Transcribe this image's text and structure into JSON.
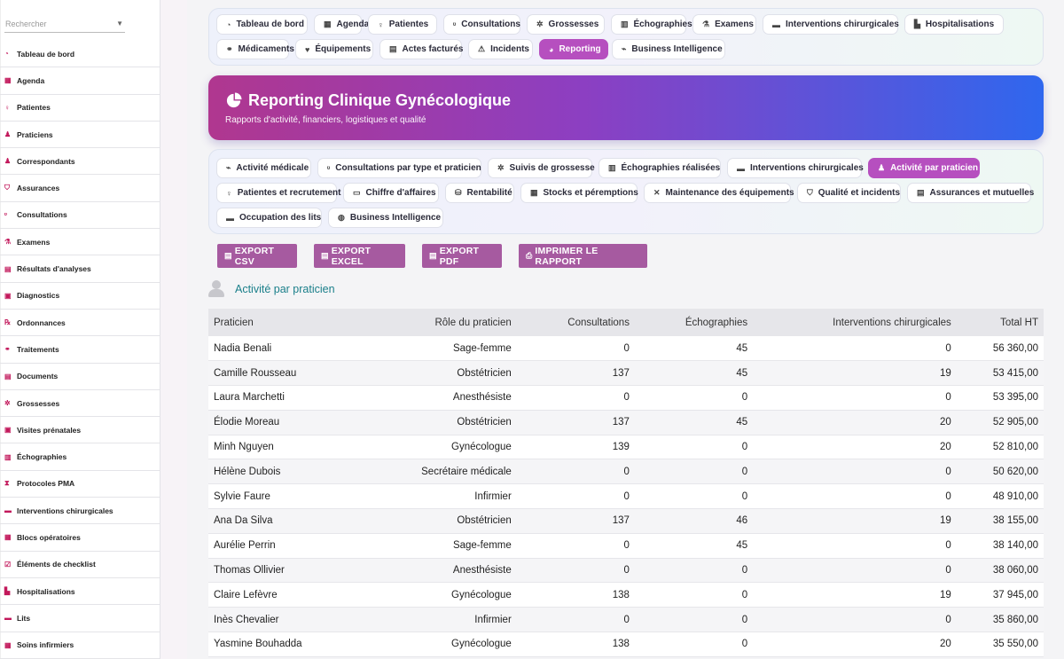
{
  "sidebar": {
    "search_placeholder": "Rechercher",
    "items": [
      {
        "label": "Tableau de bord",
        "icon": "dashboard-icon",
        "glyph": "◔"
      },
      {
        "label": "Agenda",
        "icon": "calendar-icon",
        "glyph": "▦"
      },
      {
        "label": "Patientes",
        "icon": "female-icon",
        "glyph": "♀"
      },
      {
        "label": "Praticiens",
        "icon": "user-doctor-icon",
        "glyph": "♟"
      },
      {
        "label": "Correspondants",
        "icon": "user-icon",
        "glyph": "♟"
      },
      {
        "label": "Assurances",
        "icon": "shield-icon",
        "glyph": "⛉"
      },
      {
        "label": "Consultations",
        "icon": "stethoscope-icon",
        "glyph": "ᶹ"
      },
      {
        "label": "Examens",
        "icon": "microscope-icon",
        "glyph": "⚗"
      },
      {
        "label": "Résultats d'analyses",
        "icon": "results-icon",
        "glyph": "▤"
      },
      {
        "label": "Diagnostics",
        "icon": "clipboard-icon",
        "glyph": "▣"
      },
      {
        "label": "Ordonnances",
        "icon": "prescription-icon",
        "glyph": "℞"
      },
      {
        "label": "Traitements",
        "icon": "pills-icon",
        "glyph": "⚭"
      },
      {
        "label": "Documents",
        "icon": "document-icon",
        "glyph": "▤"
      },
      {
        "label": "Grossesses",
        "icon": "baby-icon",
        "glyph": "✲"
      },
      {
        "label": "Visites prénatales",
        "icon": "visit-icon",
        "glyph": "▣"
      },
      {
        "label": "Échographies",
        "icon": "ultrasound-icon",
        "glyph": "▥"
      },
      {
        "label": "Protocoles PMA",
        "icon": "hourglass-icon",
        "glyph": "⧗"
      },
      {
        "label": "Interventions chirurgicales",
        "icon": "bed-icon",
        "glyph": "▬"
      },
      {
        "label": "Blocs opératoires",
        "icon": "operating-room-icon",
        "glyph": "▦"
      },
      {
        "label": "Éléments de checklist",
        "icon": "checklist-icon",
        "glyph": "☑"
      },
      {
        "label": "Hospitalisations",
        "icon": "hospital-icon",
        "glyph": "▙"
      },
      {
        "label": "Lits",
        "icon": "bed-icon",
        "glyph": "▬"
      },
      {
        "label": "Soins infirmiers",
        "icon": "nurse-icon",
        "glyph": "▦"
      }
    ]
  },
  "top_tabs": [
    {
      "label": "Tableau de bord",
      "icon": "dashboard-icon",
      "glyph": "◔"
    },
    {
      "label": "Agenda",
      "icon": "calendar-icon",
      "glyph": "▦"
    },
    {
      "label": "Patientes",
      "icon": "female-icon",
      "glyph": "♀"
    },
    {
      "label": "Consultations",
      "icon": "stethoscope-icon",
      "glyph": "ᶹ"
    },
    {
      "label": "Grossesses",
      "icon": "baby-icon",
      "glyph": "✲"
    },
    {
      "label": "Échographies",
      "icon": "ultrasound-icon",
      "glyph": "▥"
    },
    {
      "label": "Examens",
      "icon": "microscope-icon",
      "glyph": "⚗"
    },
    {
      "label": "Interventions chirurgicales",
      "icon": "bed-icon",
      "glyph": "▬"
    },
    {
      "label": "Hospitalisations",
      "icon": "hospital-icon",
      "glyph": "▙"
    },
    {
      "label": "Médicaments",
      "icon": "pills-icon",
      "glyph": "⚭"
    },
    {
      "label": "Équipements",
      "icon": "heart-icon",
      "glyph": "♥"
    },
    {
      "label": "Actes facturés",
      "icon": "invoice-icon",
      "glyph": "▤"
    },
    {
      "label": "Incidents",
      "icon": "warning-icon",
      "glyph": "⚠"
    },
    {
      "label": "Reporting",
      "icon": "pie-chart-icon",
      "glyph": "◕",
      "active": true
    },
    {
      "label": "Business Intelligence",
      "icon": "line-chart-icon",
      "glyph": "⌁"
    }
  ],
  "banner": {
    "title": "Reporting Clinique Gynécologique",
    "subtitle": "Rapports d'activité, financiers, logistiques et qualité"
  },
  "sub_tabs": [
    {
      "label": "Activité médicale",
      "icon": "line-chart-icon",
      "glyph": "⌁"
    },
    {
      "label": "Consultations par type et praticien",
      "icon": "stethoscope-icon",
      "glyph": "ᶹ"
    },
    {
      "label": "Suivis de grossesse",
      "icon": "baby-icon",
      "glyph": "✲"
    },
    {
      "label": "Échographies réalisées",
      "icon": "ultrasound-icon",
      "glyph": "▥"
    },
    {
      "label": "Interventions chirurgicales",
      "icon": "bed-icon",
      "glyph": "▬"
    },
    {
      "label": "Activité par praticien",
      "icon": "user-doctor-icon",
      "glyph": "♟",
      "active": true
    },
    {
      "label": "Patientes et recrutement",
      "icon": "female-icon",
      "glyph": "♀"
    },
    {
      "label": "Chiffre d'affaires",
      "icon": "money-icon",
      "glyph": "▭"
    },
    {
      "label": "Rentabilité",
      "icon": "coins-icon",
      "glyph": "⛁"
    },
    {
      "label": "Stocks et péremptions",
      "icon": "boxes-icon",
      "glyph": "▦"
    },
    {
      "label": "Maintenance des équipements",
      "icon": "tools-icon",
      "glyph": "✕"
    },
    {
      "label": "Qualité et incidents",
      "icon": "shield-icon",
      "glyph": "⛉"
    },
    {
      "label": "Assurances et mutuelles",
      "icon": "document-icon",
      "glyph": "▤"
    },
    {
      "label": "Occupation des lits",
      "icon": "bed-icon",
      "glyph": "▬"
    },
    {
      "label": "Business Intelligence",
      "icon": "brain-icon",
      "glyph": "◍"
    }
  ],
  "export_buttons": [
    {
      "label": "EXPORT CSV",
      "icon": "file-csv-icon"
    },
    {
      "label": "EXPORT EXCEL",
      "icon": "file-excel-icon"
    },
    {
      "label": "EXPORT PDF",
      "icon": "file-pdf-icon"
    },
    {
      "label": "IMPRIMER LE RAPPORT",
      "icon": "print-icon"
    }
  ],
  "section": {
    "title": "Activité par praticien"
  },
  "table": {
    "headers": [
      "Praticien",
      "Rôle du praticien",
      "Consultations",
      "Échographies",
      "Interventions chirurgicales",
      "Total HT"
    ],
    "rows": [
      [
        "Nadia Benali",
        "Sage-femme",
        "0",
        "45",
        "0",
        "56 360,00"
      ],
      [
        "Camille Rousseau",
        "Obstétricien",
        "137",
        "45",
        "19",
        "53 415,00"
      ],
      [
        "Laura Marchetti",
        "Anesthésiste",
        "0",
        "0",
        "0",
        "53 395,00"
      ],
      [
        "Élodie Moreau",
        "Obstétricien",
        "137",
        "45",
        "20",
        "52 905,00"
      ],
      [
        "Minh Nguyen",
        "Gynécologue",
        "139",
        "0",
        "20",
        "52 810,00"
      ],
      [
        "Hélène Dubois",
        "Secrétaire médicale",
        "0",
        "0",
        "0",
        "50 620,00"
      ],
      [
        "Sylvie Faure",
        "Infirmier",
        "0",
        "0",
        "0",
        "48 910,00"
      ],
      [
        "Ana Da Silva",
        "Obstétricien",
        "137",
        "46",
        "19",
        "38 155,00"
      ],
      [
        "Aurélie Perrin",
        "Sage-femme",
        "0",
        "45",
        "0",
        "38 140,00"
      ],
      [
        "Thomas Ollivier",
        "Anesthésiste",
        "0",
        "0",
        "0",
        "38 060,00"
      ],
      [
        "Claire Lefèvre",
        "Gynécologue",
        "138",
        "0",
        "19",
        "37 945,00"
      ],
      [
        "Inès Chevalier",
        "Infirmier",
        "0",
        "0",
        "0",
        "35 860,00"
      ],
      [
        "Yasmine Bouhadda",
        "Gynécologue",
        "138",
        "0",
        "20",
        "35 550,00"
      ]
    ]
  }
}
